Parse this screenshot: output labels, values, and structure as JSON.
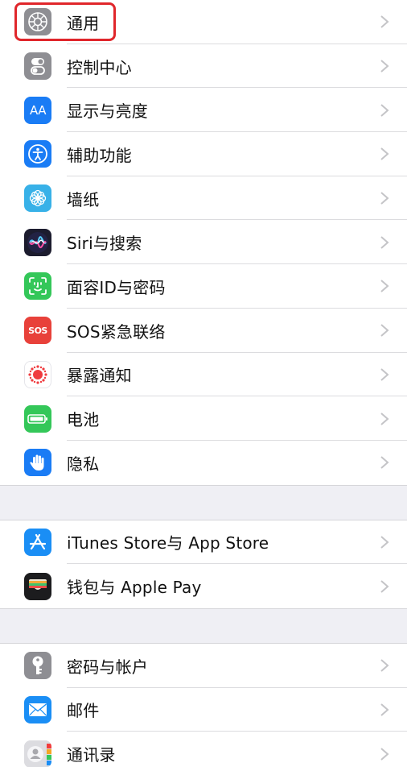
{
  "settings": {
    "group1": [
      {
        "label": "通用",
        "icon": "gear-icon",
        "color": "#8e8e93"
      },
      {
        "label": "控制中心",
        "icon": "control-center-icon",
        "color": "#8e8e93"
      },
      {
        "label": "显示与亮度",
        "icon": "display-aa-icon",
        "color": "#1a7cf5",
        "icon_text": "AA"
      },
      {
        "label": "辅助功能",
        "icon": "accessibility-icon",
        "color": "#1a7cf5"
      },
      {
        "label": "墙纸",
        "icon": "wallpaper-flower-icon",
        "color": "#38b1e8"
      },
      {
        "label": "Siri与搜索",
        "icon": "siri-icon",
        "color": "#1c1c2e"
      },
      {
        "label": "面容ID与密码",
        "icon": "face-id-icon",
        "color": "#34c759"
      },
      {
        "label": "SOS紧急联络",
        "icon": "sos-icon",
        "color": "#e8413a",
        "icon_text": "SOS"
      },
      {
        "label": "暴露通知",
        "icon": "exposure-notification-icon",
        "color": "#ffffff"
      },
      {
        "label": "电池",
        "icon": "battery-icon",
        "color": "#34c759"
      },
      {
        "label": "隐私",
        "icon": "privacy-hand-icon",
        "color": "#1a7cf5"
      }
    ],
    "group2": [
      {
        "label": "iTunes Store与 App Store",
        "icon": "app-store-icon",
        "color": "#1a8ef5"
      },
      {
        "label": "钱包与 Apple Pay",
        "icon": "wallet-icon",
        "color": "#1c1c1e"
      }
    ],
    "group3": [
      {
        "label": "密码与帐户",
        "icon": "key-icon",
        "color": "#8e8e93"
      },
      {
        "label": "邮件",
        "icon": "mail-icon",
        "color": "#1a8ef5"
      },
      {
        "label": "通讯录",
        "icon": "contacts-icon",
        "color": "#d4d4d8"
      }
    ]
  },
  "highlight_color": "#e0262b"
}
